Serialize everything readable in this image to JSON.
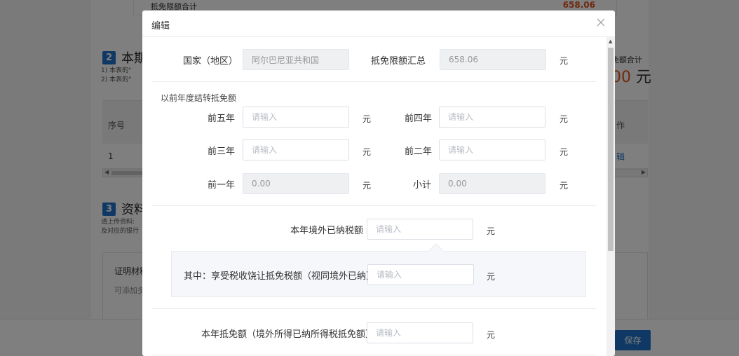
{
  "background": {
    "top_total_label": "抵免限额合计",
    "top_total_value": "658.06",
    "section2": {
      "num": "2",
      "title": "本期",
      "notes": [
        "1) 本表的“",
        "2) 本表的“"
      ]
    },
    "right_sum_label": "免额合计",
    "right_big_value": "00",
    "right_big_unit": "元",
    "table": {
      "col_index": "序号",
      "col_action": "作",
      "row_index": "1",
      "row_action": "辑"
    },
    "section3": {
      "num": "3",
      "title": "资料",
      "notes": [
        "请上传资料:",
        "及对应的银行"
      ]
    },
    "proof": {
      "title": "证明材料",
      "hint": "可添加多"
    },
    "save_label": "保存"
  },
  "modal": {
    "title": "编辑",
    "country_label": "国家（地区）",
    "country_value": "阿尔巴尼亚共和国",
    "limit_label": "抵免限额汇总",
    "limit_value": "658.06",
    "unit": "元",
    "carry_title": "以前年度结转抵免额",
    "placeholder": "请输入",
    "year5_label": "前五年",
    "year4_label": "前四年",
    "year3_label": "前三年",
    "year2_label": "前二年",
    "year1_label": "前一年",
    "year1_value": "0.00",
    "subtotal_label": "小计",
    "subtotal_value": "0.00",
    "foreign_paid_label": "本年境外已纳税额",
    "incentive_label": "其中：享受税收饶让抵免税额（视同境外已纳）",
    "current_credit_label": "本年抵免额（境外所得已纳所得税抵免额）"
  },
  "colors": {
    "accent": "#1f72c9",
    "highlight": "#e0531f"
  }
}
